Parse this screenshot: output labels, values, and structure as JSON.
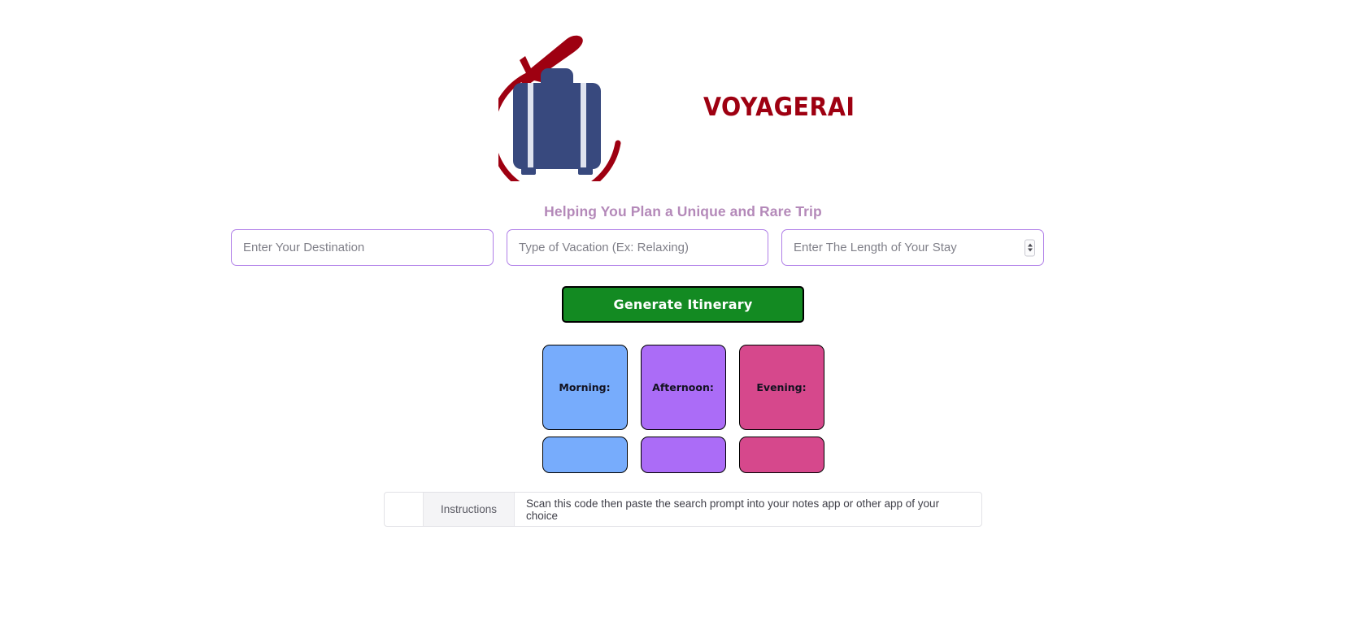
{
  "brand": {
    "word": "VOYAGERAI",
    "logo_icon": "suitcase-airplane-icon",
    "suitcase_color": "#38497e",
    "accent_color": "#9e0011"
  },
  "tagline": "Helping You Plan a Unique and Rare Trip",
  "form": {
    "destination": {
      "placeholder": "Enter Your Destination",
      "value": ""
    },
    "vacation_type": {
      "placeholder": "Type of Vacation (Ex: Relaxing)",
      "value": ""
    },
    "length_of_stay": {
      "placeholder": "Enter The Length of Your Stay",
      "value": ""
    },
    "border_color": "#b07fe8"
  },
  "actions": {
    "generate_label": "Generate Itinerary",
    "generate_color": "#138a22"
  },
  "cards": [
    {
      "label": "Morning:",
      "color": "#77acfc",
      "body": ""
    },
    {
      "label": "Afternoon:",
      "color": "#ab6cf7",
      "body": ""
    },
    {
      "label": "Evening:",
      "color": "#d6488c",
      "body": ""
    }
  ],
  "instructions": {
    "blank": "",
    "label": "Instructions",
    "text": "Scan this code then paste the search prompt into your notes app or other app of your choice"
  }
}
